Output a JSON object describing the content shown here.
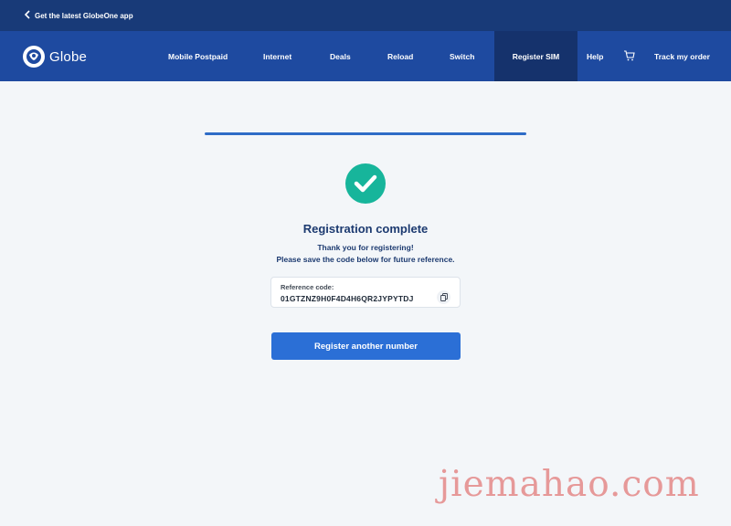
{
  "topbar": {
    "back_icon": "chevron-left-icon",
    "app_link": "Get the latest GlobeOne app"
  },
  "brand": {
    "name": "Globe"
  },
  "nav": {
    "items": [
      {
        "label": "Mobile Postpaid"
      },
      {
        "label": "Internet"
      },
      {
        "label": "Deals"
      },
      {
        "label": "Reload"
      },
      {
        "label": "Switch"
      },
      {
        "label": "Register SIM",
        "active": true
      },
      {
        "label": "Help"
      },
      {
        "label": "Track my order"
      }
    ],
    "cart_icon": "cart-icon"
  },
  "status": {
    "title": "Registration complete",
    "line1": "Thank you for registering!",
    "line2": "Please save the code below for future reference."
  },
  "reference": {
    "label": "Reference code:",
    "code": "01GTZNZ9H0F4D4H6QR2JYPYTDJ",
    "copy_icon": "copy-icon"
  },
  "actions": {
    "primary_label": "Register another number"
  },
  "watermark": {
    "text": "jiemahao.com"
  },
  "colors": {
    "header_dark": "#183a78",
    "nav": "#1e4aa0",
    "accent": "#2b6fd6",
    "success": "#17b59b"
  }
}
